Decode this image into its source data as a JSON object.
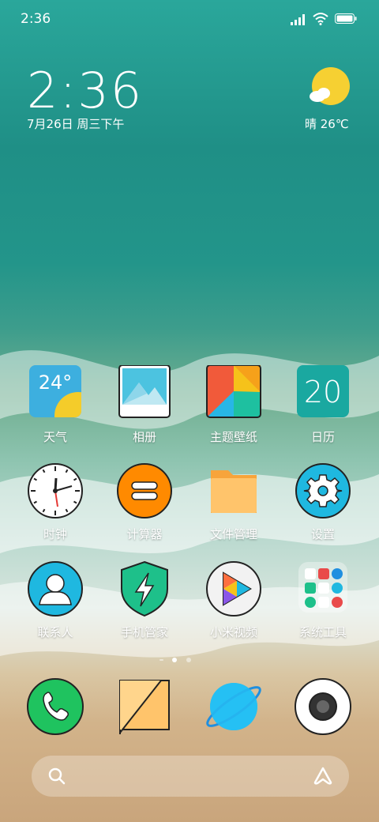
{
  "status_bar": {
    "time": "2:36"
  },
  "clock_widget": {
    "time": "2:36",
    "date": "7月26日 周三下午"
  },
  "weather_widget": {
    "condition": "晴",
    "temperature": "26℃",
    "text": "晴 26℃"
  },
  "apps": [
    {
      "label": "天气",
      "icon": "weather-icon",
      "value": "24°"
    },
    {
      "label": "相册",
      "icon": "gallery-icon"
    },
    {
      "label": "主题壁纸",
      "icon": "themes-icon"
    },
    {
      "label": "日历",
      "icon": "calendar-icon",
      "value": "20"
    },
    {
      "label": "时钟",
      "icon": "clock-icon"
    },
    {
      "label": "计算器",
      "icon": "calculator-icon"
    },
    {
      "label": "文件管理",
      "icon": "folder-icon"
    },
    {
      "label": "设置",
      "icon": "gear-icon"
    },
    {
      "label": "联系人",
      "icon": "contact-icon"
    },
    {
      "label": "手机管家",
      "icon": "shield-icon"
    },
    {
      "label": "小米视频",
      "icon": "video-icon"
    },
    {
      "label": "系统工具",
      "icon": "folder-tools-icon"
    }
  ],
  "dock": [
    {
      "icon": "phone-icon"
    },
    {
      "icon": "messages-icon"
    },
    {
      "icon": "browser-icon"
    },
    {
      "icon": "camera-icon"
    }
  ],
  "page_indicator": {
    "pages": 3,
    "current": 2
  },
  "search": {
    "icon": "search-icon",
    "assistant_icon": "assistant-icon"
  },
  "colors": {
    "accent_orange": "#ff8a00",
    "accent_teal": "#1aa8a0",
    "weather_yellow": "#f4cc2a",
    "phone_green": "#1fc35f"
  }
}
